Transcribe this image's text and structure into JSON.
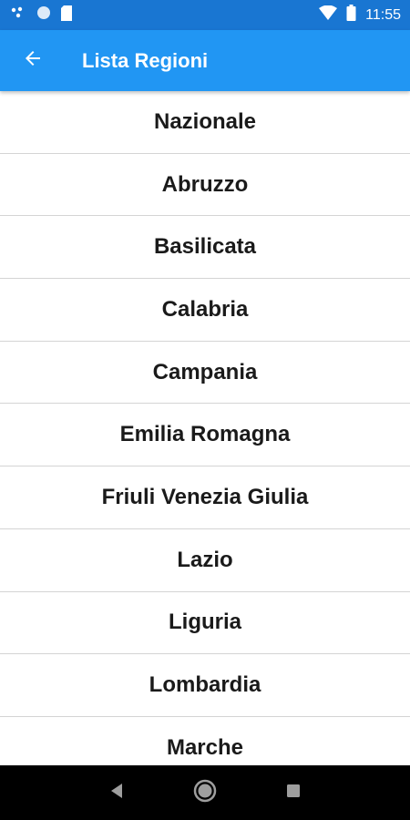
{
  "status_bar": {
    "time": "11:55",
    "icons": [
      "notification-dots-icon",
      "circle-icon",
      "sd-card-icon",
      "wifi-icon",
      "battery-icon"
    ]
  },
  "app_bar": {
    "title": "Lista Regioni",
    "back_icon": "arrow-left-icon"
  },
  "regions": [
    "Nazionale",
    "Abruzzo",
    "Basilicata",
    "Calabria",
    "Campania",
    "Emilia Romagna",
    "Friuli Venezia Giulia",
    "Lazio",
    "Liguria",
    "Lombardia",
    "Marche"
  ],
  "nav_bar": {
    "buttons": [
      "back-triangle-icon",
      "home-circle-icon",
      "recents-square-icon"
    ]
  },
  "colors": {
    "status_bar": "#1976d2",
    "app_bar": "#2196f3",
    "divider": "#d4d4d4",
    "nav_bar": "#000000"
  }
}
